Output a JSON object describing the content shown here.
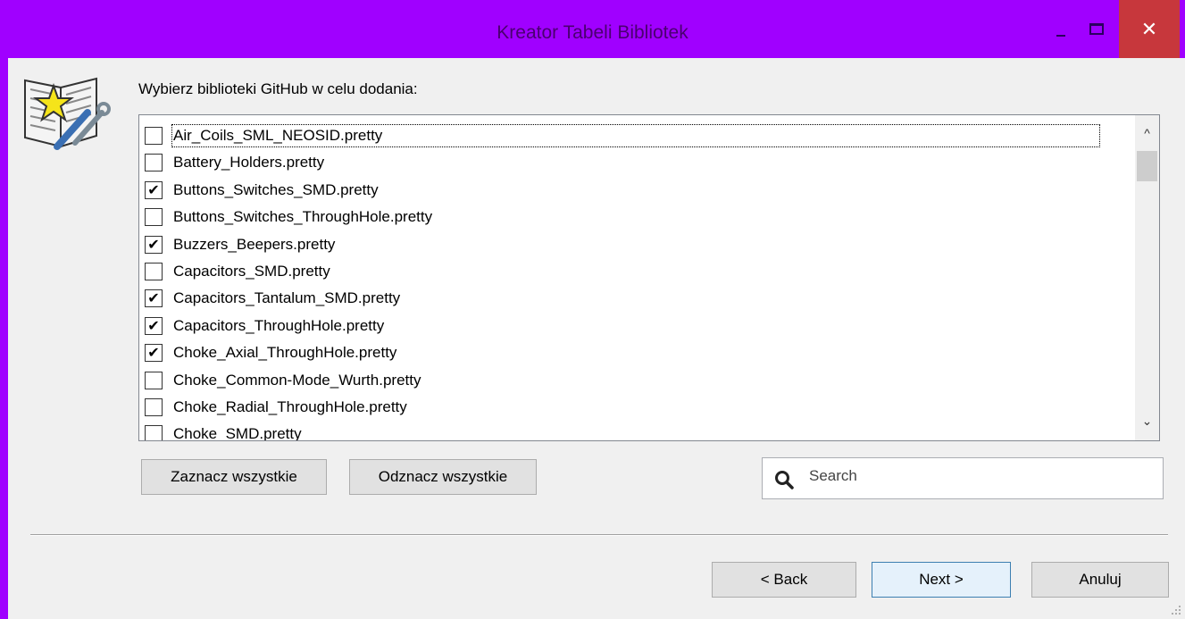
{
  "window": {
    "title": "Kreator Tabeli Bibliotek",
    "close_glyph": "✕",
    "accent_color": "#a000ff"
  },
  "prompt": "Wybierz biblioteki GitHub w celu dodania:",
  "libraries": [
    {
      "name": "Air_Coils_SML_NEOSID.pretty",
      "checked": false,
      "focused": true
    },
    {
      "name": "Battery_Holders.pretty",
      "checked": false
    },
    {
      "name": "Buttons_Switches_SMD.pretty",
      "checked": true
    },
    {
      "name": "Buttons_Switches_ThroughHole.pretty",
      "checked": false
    },
    {
      "name": "Buzzers_Beepers.pretty",
      "checked": true
    },
    {
      "name": "Capacitors_SMD.pretty",
      "checked": false
    },
    {
      "name": "Capacitors_Tantalum_SMD.pretty",
      "checked": true
    },
    {
      "name": "Capacitors_ThroughHole.pretty",
      "checked": true
    },
    {
      "name": "Choke_Axial_ThroughHole.pretty",
      "checked": true
    },
    {
      "name": "Choke_Common-Mode_Wurth.pretty",
      "checked": false
    },
    {
      "name": "Choke_Radial_ThroughHole.pretty",
      "checked": false
    },
    {
      "name": "Choke_SMD.pretty",
      "checked": false
    }
  ],
  "scrollbar": {
    "up_glyph": "^",
    "down_glyph": "⌄"
  },
  "buttons": {
    "select_all": "Zaznacz wszystkie",
    "deselect_all": "Odznacz wszystkie",
    "back": "< Back",
    "next": "Next >",
    "cancel": "Anuluj"
  },
  "search": {
    "placeholder": "Search",
    "icon": "magnifier-icon"
  }
}
